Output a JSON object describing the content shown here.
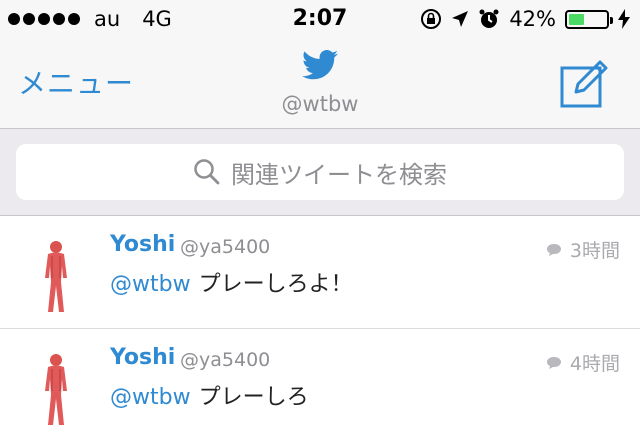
{
  "status_bar": {
    "carrier": "au",
    "network": "4G",
    "time": "2:07",
    "battery_percent": "42%",
    "battery_level": 0.42,
    "signal_dots": 5,
    "icons": [
      "rotation-lock-icon",
      "location-arrow-icon",
      "alarm-icon",
      "charging-bolt-icon"
    ]
  },
  "nav": {
    "menu_label": "メニュー",
    "handle": "@wtbw",
    "icons": [
      "twitter-bird-icon",
      "compose-icon"
    ],
    "accent_color": "#2f8ad2"
  },
  "search": {
    "placeholder": "関連ツイートを検索",
    "icon": "search-icon"
  },
  "tweets": [
    {
      "name": "Yoshi",
      "screen_name": "@ya5400",
      "time": "3時間",
      "mention": "@wtbw",
      "text": "プレーしろよ！"
    },
    {
      "name": "Yoshi",
      "screen_name": "@ya5400",
      "time": "4時間",
      "mention": "@wtbw",
      "text": "プレーしろ"
    }
  ]
}
